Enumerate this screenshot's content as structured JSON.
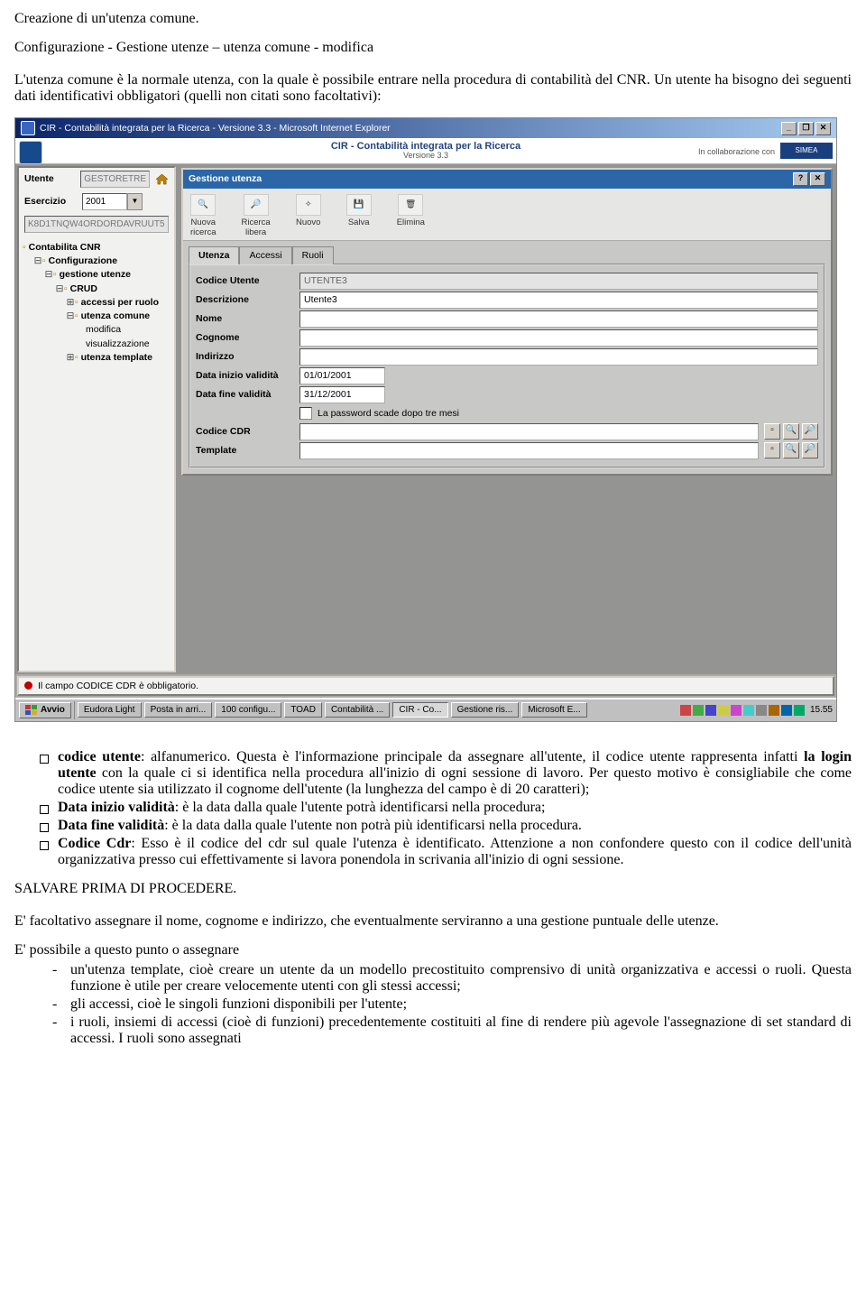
{
  "doc": {
    "title": "Creazione di un'utenza comune.",
    "breadcrumb": "Configurazione - Gestione utenze – utenza comune - modifica",
    "intro": "L'utenza comune è la normale utenza, con la quale è possibile entrare nella procedura di contabilità del CNR. Un utente ha bisogno dei seguenti dati identificativi obbligatori (quelli non citati sono facoltativi):",
    "bullets": {
      "b1a": "codice utente",
      "b1b": ": alfanumerico. Questa è l'informazione principale da assegnare all'utente, il codice utente rappresenta infatti ",
      "b1c": "la login utente",
      "b1d": " con la quale ci si identifica nella procedura all'inizio di ogni sessione di lavoro. Per questo motivo è consigliabile che come codice utente sia utilizzato il cognome dell'utente (la lunghezza del campo è di 20 caratteri);",
      "b2a": "Data inizio validità",
      "b2b": ": è la data dalla quale l'utente potrà identificarsi nella procedura;",
      "b3a": "Data fine validità",
      "b3b": ": è la data dalla quale l'utente non potrà più identificarsi nella procedura.",
      "b4a": "Codice Cdr",
      "b4b": ": Esso è il codice del cdr sul quale l'utenza è identificato. Attenzione a non confondere questo con il codice dell'unità organizzativa presso cui effettivamente si lavora ponendola in scrivania all'inizio di ogni sessione."
    },
    "salva": "SALVARE PRIMA DI PROCEDERE.",
    "p2": "E' facoltativo assegnare il nome, cognome e indirizzo, che eventualmente serviranno a una gestione puntuale delle utenze.",
    "p3": "E' possibile a questo punto o assegnare",
    "sub": {
      "s1": "un'utenza template, cioè creare un utente da un modello precostituito comprensivo di unità organizzativa e accessi o ruoli. Questa funzione è utile per creare velocemente utenti con gli stessi accessi;",
      "s2": "gli accessi, cioè le singoli funzioni disponibili per l'utente;",
      "s3": "i ruoli, insiemi di accessi (cioè di funzioni) precedentemente costituiti al fine di rendere più agevole l'assegnazione di set standard di accessi. I ruoli sono assegnati"
    }
  },
  "win": {
    "title": "CIR - Contabilità integrata per la Ricerca - Versione 3.3 - Microsoft Internet Explorer",
    "appTitle": "CIR - Contabilità integrata per la Ricerca",
    "appVer": "Versione 3.3",
    "collab": "In collaborazione con"
  },
  "sidebar": {
    "utenteLbl": "Utente",
    "utenteVal": "GESTORETRE",
    "esercLbl": "Esercizio",
    "esercVal": "2001",
    "code": "K8D1TNQW4ORDORDAVRUUT5",
    "tree": {
      "n0": "Contabilita CNR",
      "n1": "Configurazione",
      "n2": "gestione utenze",
      "n3": "CRUD",
      "n4": "accessi per ruolo",
      "n5": "utenza comune",
      "n6": "modifica",
      "n7": "visualizzazione",
      "n8": "utenza template"
    }
  },
  "section": {
    "title": "Gestione utenza",
    "toolbar": {
      "t1a": "Nuova",
      "t1b": "ricerca",
      "t2a": "Ricerca",
      "t2b": "libera",
      "t3": "Nuovo",
      "t4": "Salva",
      "t5": "Elimina"
    },
    "tabs": {
      "t1": "Utenza",
      "t2": "Accessi",
      "t3": "Ruoli"
    },
    "form": {
      "f1l": "Codice Utente",
      "f1v": "UTENTE3",
      "f2l": "Descrizione",
      "f2v": "Utente3",
      "f3l": "Nome",
      "f4l": "Cognome",
      "f5l": "Indirizzo",
      "f6l": "Data inizio validità",
      "f6v": "01/01/2001",
      "f7l": "Data fine validità",
      "f7v": "31/12/2001",
      "chk": "La password scade dopo tre mesi",
      "f8l": "Codice CDR",
      "f9l": "Template"
    }
  },
  "status": "Il campo CODICE CDR è obbligatorio.",
  "taskbar": {
    "start": "Avvio",
    "b1": "Eudora Light",
    "b2": "Posta in arri...",
    "b3": "100 configu...",
    "b4": "TOAD",
    "b5": "Contabilità ...",
    "b6": "CIR - Co...",
    "b7": "Gestione ris...",
    "b8": "Microsoft E...",
    "time": "15.55"
  }
}
